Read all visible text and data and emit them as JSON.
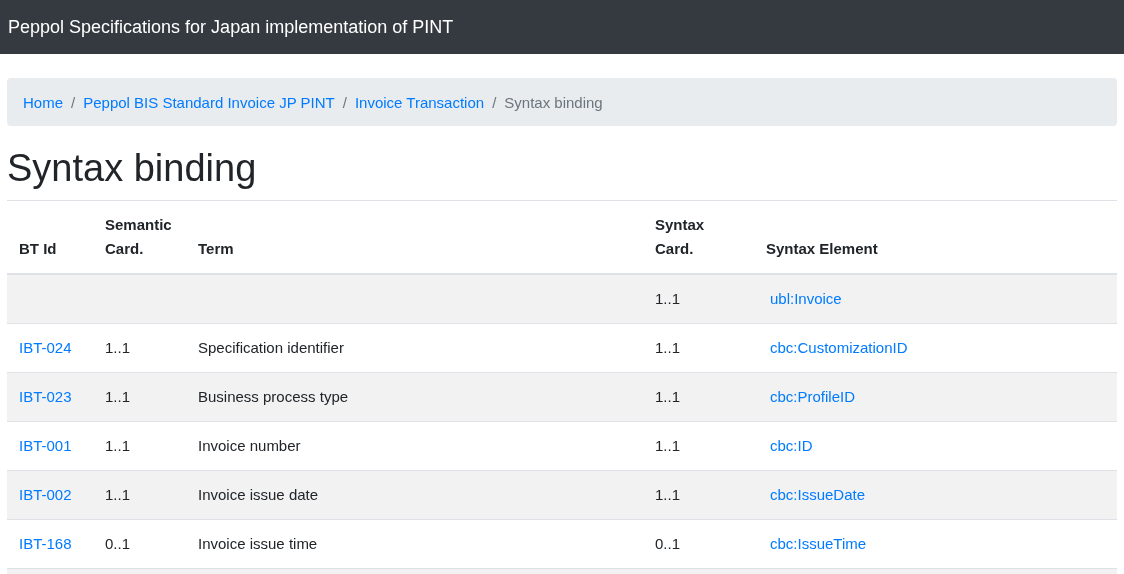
{
  "navbar": {
    "title": "Peppol Specifications for Japan implementation of PINT"
  },
  "breadcrumb": [
    {
      "label": "Home",
      "link": true
    },
    {
      "separator": "/",
      "label": "Peppol BIS Standard Invoice JP PINT",
      "link": true
    },
    {
      "separator": "/",
      "label": "Invoice Transaction",
      "link": true
    },
    {
      "separator": "/",
      "label": "Syntax binding",
      "link": false
    }
  ],
  "heading": "Syntax binding",
  "table": {
    "columns": [
      [
        "BT Id"
      ],
      [
        "Semantic",
        "Card."
      ],
      [
        "Term"
      ],
      [
        "Syntax",
        "Card."
      ],
      [
        "Syntax Element"
      ]
    ],
    "rows": [
      {
        "syntax_card": "1..1",
        "syntax_element": "ubl:Invoice"
      },
      {
        "bt_id": "IBT-024",
        "semantic_card": "1..1",
        "term": "Specification identifier",
        "syntax_card": "1..1",
        "syntax_element": "cbc:CustomizationID"
      },
      {
        "bt_id": "IBT-023",
        "semantic_card": "1..1",
        "term": "Business process type",
        "syntax_card": "1..1",
        "syntax_element": "cbc:ProfileID"
      },
      {
        "bt_id": "IBT-001",
        "semantic_card": "1..1",
        "term": "Invoice number",
        "syntax_card": "1..1",
        "syntax_element": "cbc:ID"
      },
      {
        "bt_id": "IBT-002",
        "semantic_card": "1..1",
        "term": "Invoice issue date",
        "syntax_card": "1..1",
        "syntax_element": "cbc:IssueDate"
      },
      {
        "bt_id": "IBT-168",
        "semantic_card": "0..1",
        "term": "Invoice issue time",
        "syntax_card": "0..1",
        "syntax_element": "cbc:IssueTime"
      }
    ]
  }
}
